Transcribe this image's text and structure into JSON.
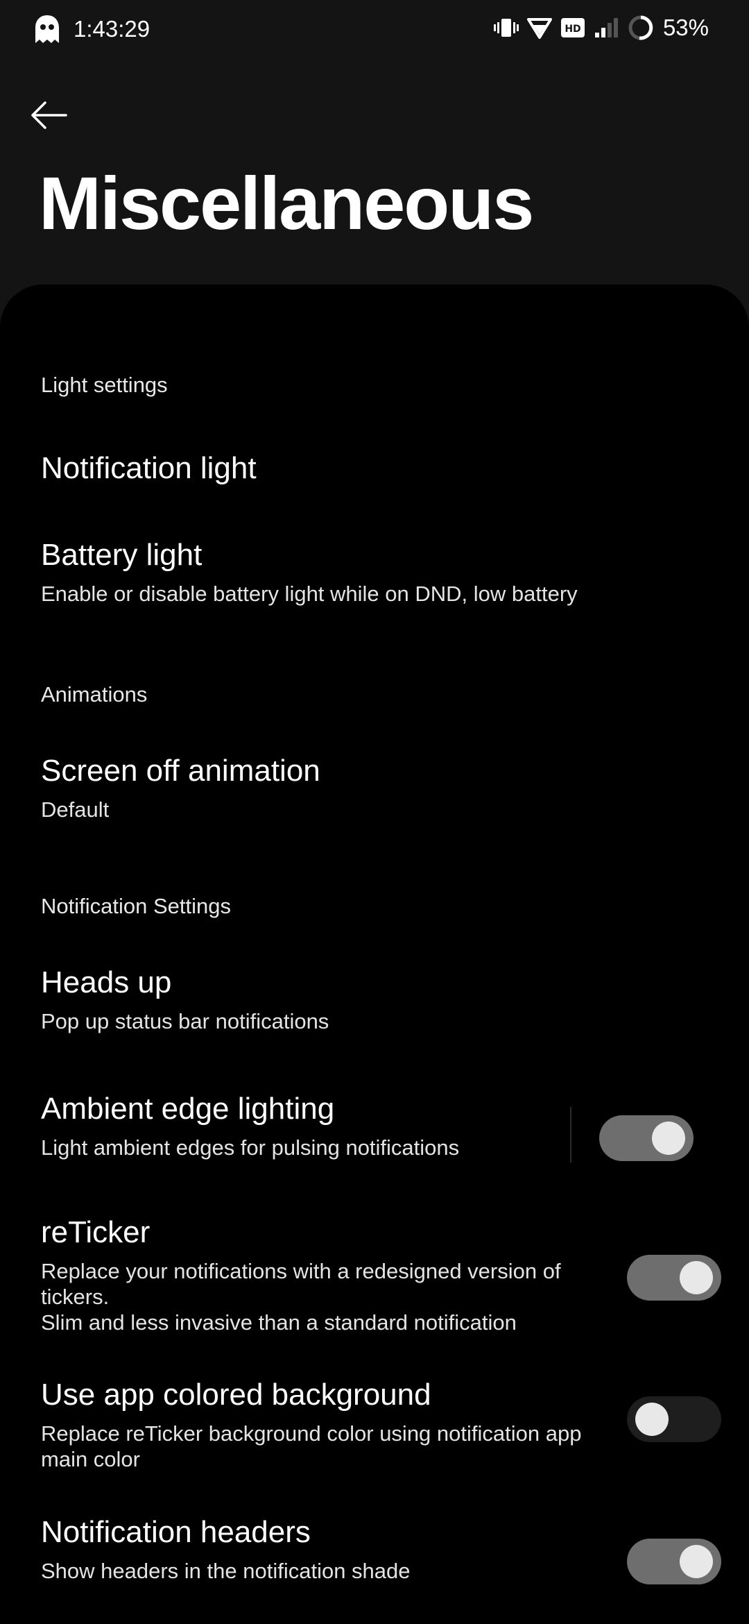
{
  "status_bar": {
    "time": "1:43:29",
    "battery_percent": "53%",
    "icons": [
      "ghost-icon",
      "vibrate-icon",
      "wifi-icon",
      "hd-icon",
      "cell-signal-icon",
      "battery-icon"
    ]
  },
  "header": {
    "title": "Miscellaneous",
    "back_icon": "arrow-left-icon"
  },
  "sections": {
    "light": {
      "header": "Light settings",
      "notification_light": {
        "title": "Notification light"
      },
      "battery_light": {
        "title": "Battery light",
        "summary": "Enable or disable battery light while on DND, low battery"
      }
    },
    "animations": {
      "header": "Animations",
      "screen_off": {
        "title": "Screen off animation",
        "summary": "Default"
      }
    },
    "notifications": {
      "header": "Notification Settings",
      "heads_up": {
        "title": "Heads up",
        "summary": "Pop up status bar notifications"
      },
      "ambient_edge": {
        "title": "Ambient edge lighting",
        "summary": "Light ambient edges for pulsing notifications",
        "enabled": true
      },
      "reticker": {
        "title": "reTicker",
        "summary_line1": "Replace your notifications with a redesigned version of",
        "summary_line2": "tickers.",
        "summary_line3": "Slim and less invasive than a standard notification",
        "enabled": true
      },
      "app_colored_bg": {
        "title": "Use app colored background",
        "summary_line1": "Replace reTicker background color using notification app",
        "summary_line2": "main color",
        "enabled": false
      },
      "notification_headers": {
        "title": "Notification headers",
        "summary": "Show headers in the notification shade",
        "enabled": true
      }
    }
  },
  "colors": {
    "background": "#000000",
    "header_background": "#141414",
    "toggle_on_track": "#6e6e6e",
    "toggle_off_track": "#1e1e1e",
    "toggle_knob": "#e8e8e8"
  }
}
